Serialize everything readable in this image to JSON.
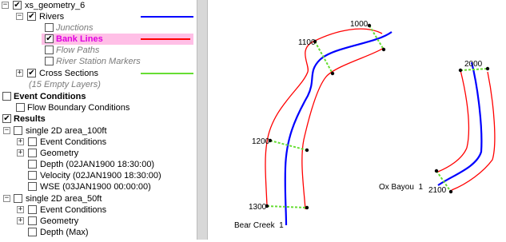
{
  "layers": {
    "geometry": "xs_geometry_6",
    "rivers": "Rivers",
    "junctions": "Junctions",
    "bank_lines": "Bank Lines",
    "flow_paths": "Flow Paths",
    "river_station_markers": "River Station Markers",
    "cross_sections": "Cross Sections",
    "empty_layers": "(15 Empty Layers)",
    "event_conditions_header": "Event Conditions",
    "flow_boundary_conditions": "Flow Boundary Conditions",
    "results_header": "Results",
    "area_100": {
      "name": "single 2D area_100ft",
      "event_conditions": "Event Conditions",
      "geometry": "Geometry",
      "depth": "Depth (02JAN1900 18:30:00)",
      "velocity": "Velocity (02JAN1900 18:30:00)",
      "wse": "WSE (03JAN1900 00:00:00)"
    },
    "area_50": {
      "name": "single 2D area_50ft",
      "event_conditions": "Event Conditions",
      "geometry": "Geometry",
      "depth": "Depth (Max)"
    }
  },
  "swatch_colors": {
    "rivers": "#0000ff",
    "bank_lines": "#ff0000",
    "cross_sections": "#66dd33"
  },
  "map": {
    "cross_section_labels": [
      "1000",
      "1100",
      "1200",
      "1300",
      "2000",
      "2100"
    ],
    "river_labels": [
      "Bear Creek  1",
      "Ox Bayou  1"
    ]
  }
}
